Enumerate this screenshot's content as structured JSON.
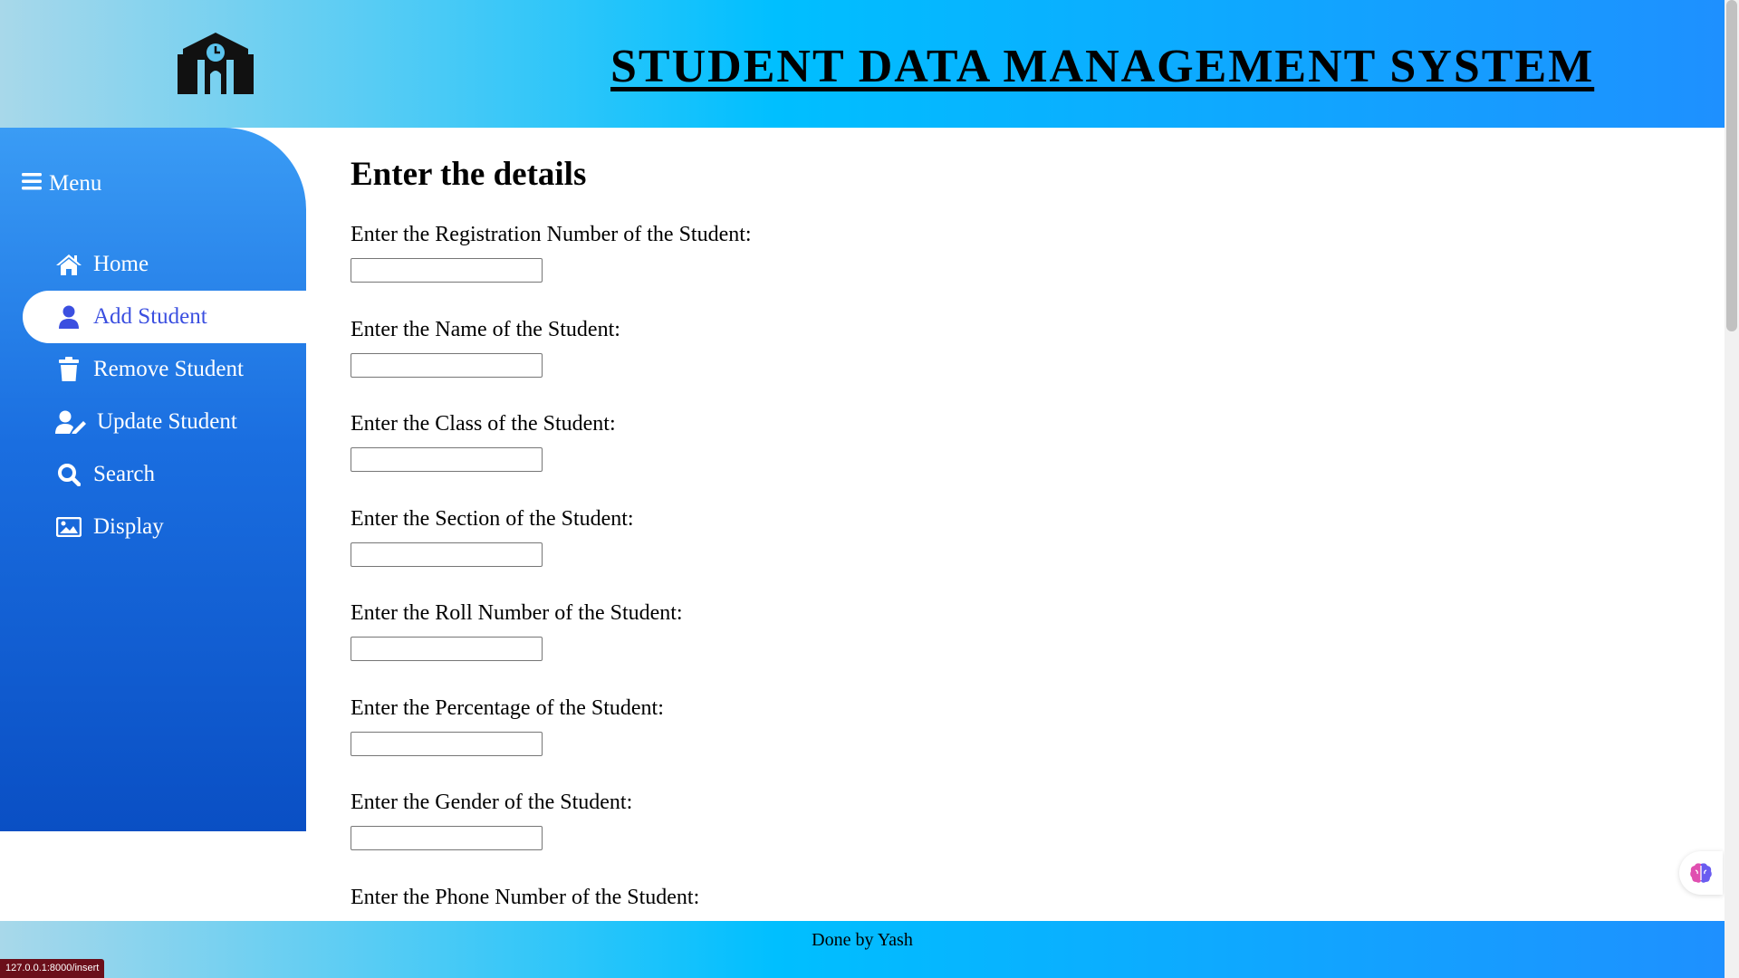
{
  "header": {
    "logo_icon": "school-icon",
    "title": "STUDENT DATA MANAGEMENT SYSTEM"
  },
  "sidebar": {
    "menu_label": "Menu",
    "items": [
      {
        "label": "Home",
        "icon": "home-icon",
        "active": false
      },
      {
        "label": "Add Student",
        "icon": "user-icon",
        "active": true
      },
      {
        "label": "Remove Student",
        "icon": "trash-icon",
        "active": false
      },
      {
        "label": "Update Student",
        "icon": "user-edit-icon",
        "active": false
      },
      {
        "label": "Search",
        "icon": "search-icon",
        "active": false
      },
      {
        "label": "Display",
        "icon": "image-icon",
        "active": false
      }
    ]
  },
  "main": {
    "heading": "Enter the details",
    "fields": [
      {
        "label": "Enter the Registration Number of the Student:",
        "value": ""
      },
      {
        "label": "Enter the Name of the Student:",
        "value": ""
      },
      {
        "label": "Enter the Class of the Student:",
        "value": ""
      },
      {
        "label": "Enter the Section of the Student:",
        "value": ""
      },
      {
        "label": "Enter the Roll Number of the Student:",
        "value": ""
      },
      {
        "label": "Enter the Percentage of the Student:",
        "value": ""
      },
      {
        "label": "Enter the Gender of the Student:",
        "value": ""
      },
      {
        "label": "Enter the Phone Number of the Student:",
        "value": ""
      }
    ]
  },
  "footer": {
    "text": "Done by Yash"
  },
  "status_bar": {
    "url": "127.0.0.1:8000/insert"
  },
  "colors": {
    "header_gradient": [
      "#a8d8ea",
      "#00bfff",
      "#1e90ff"
    ],
    "sidebar_gradient": [
      "#3a9cf5",
      "#0a4fc4"
    ],
    "active_item_text": "#3b4fe0"
  }
}
